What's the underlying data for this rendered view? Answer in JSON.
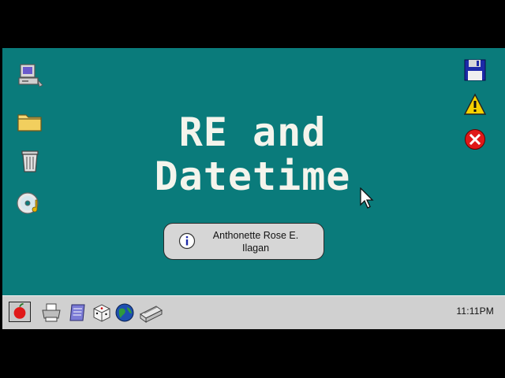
{
  "desktop": {
    "left_icons": [
      {
        "icon": "computer-icon"
      },
      {
        "icon": "folder-icon"
      },
      {
        "icon": "trash-icon"
      },
      {
        "icon": "cd-audio-icon"
      }
    ],
    "right_icons": [
      {
        "icon": "floppy-disk-icon"
      },
      {
        "icon": "warning-icon"
      },
      {
        "icon": "error-icon"
      }
    ]
  },
  "title": {
    "line1": "RE and",
    "line2": "Datetime"
  },
  "author": {
    "line1": "Anthonette Rose E.",
    "line2": "Ilagan",
    "icon": "info-icon"
  },
  "taskbar": {
    "start_icon": "apple-icon",
    "apps": [
      {
        "icon": "printer-icon"
      },
      {
        "icon": "notepad-icon"
      },
      {
        "icon": "dice-icon"
      },
      {
        "icon": "globe-icon"
      },
      {
        "icon": "scanner-icon"
      }
    ],
    "clock": "11:11PM"
  },
  "colors": {
    "desktop_bg": "#0a7b7b",
    "title_text": "#f4f4ec",
    "taskbar_bg": "#d0d0d0"
  }
}
